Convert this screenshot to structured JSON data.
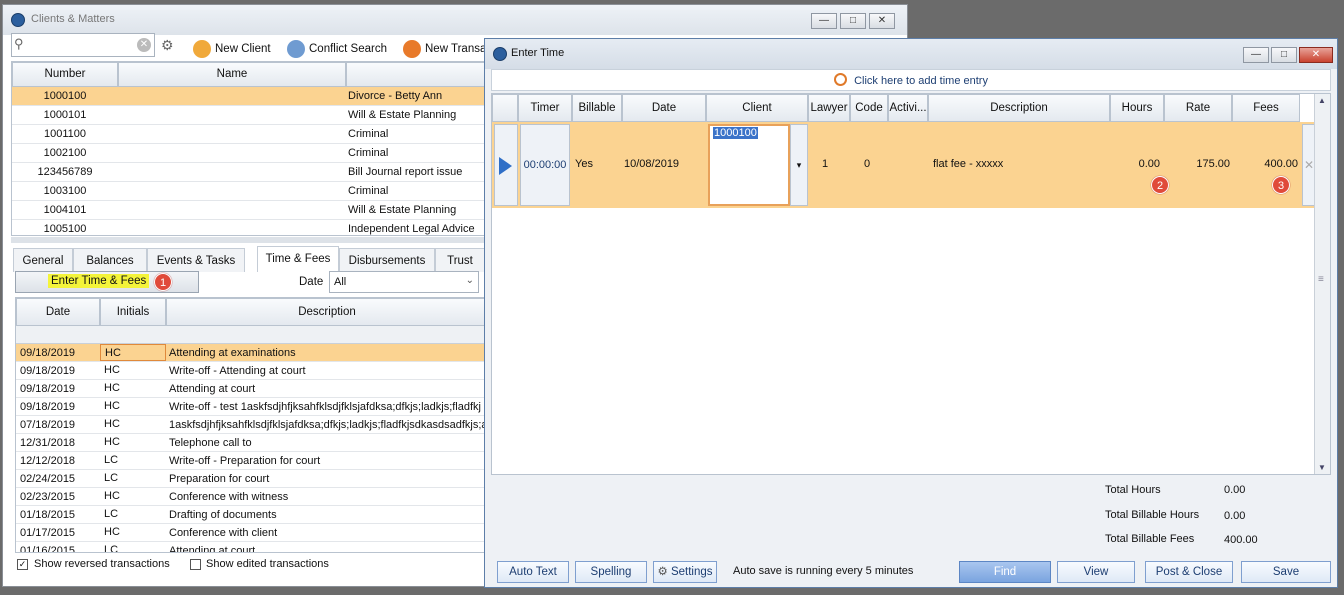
{
  "clients_window": {
    "title": "Clients & Matters",
    "toolbar": {
      "new_client": "New Client",
      "conflict_search": "Conflict Search",
      "new_transaction": "New Transa"
    },
    "columns": [
      "Number",
      "Name"
    ],
    "rows": [
      {
        "number": "1000100",
        "matter": "Divorce - Betty Ann"
      },
      {
        "number": "1000101",
        "matter": "Will & Estate Planning"
      },
      {
        "number": "1001100",
        "matter": "Criminal"
      },
      {
        "number": "1002100",
        "matter": "Criminal"
      },
      {
        "number": "123456789",
        "matter": "Bill Journal report issue"
      },
      {
        "number": "1003100",
        "matter": "Criminal"
      },
      {
        "number": "1004101",
        "matter": "Will & Estate Planning"
      },
      {
        "number": "1005100",
        "matter": "Independent Legal Advice"
      }
    ],
    "tabs": [
      "General",
      "Balances",
      "Events & Tasks",
      "Time & Fees",
      "Disbursements",
      "Trust"
    ],
    "enter_time_button": "Enter Time & Fees",
    "date_filter_label": "Date",
    "date_filter_value": "All",
    "txn_columns": [
      "Date",
      "Initials",
      "Description"
    ],
    "transactions": [
      {
        "date": "09/18/2019",
        "initials": "HC",
        "description": "Attending at examinations"
      },
      {
        "date": "09/18/2019",
        "initials": "HC",
        "description": "Write-off -  Attending at court"
      },
      {
        "date": "09/18/2019",
        "initials": "HC",
        "description": "Attending at court"
      },
      {
        "date": "09/18/2019",
        "initials": "HC",
        "description": "Write-off  -  test  1askfsdjhfjksahfklsdjfklsjafdksa;dfkjs;ladkjs;fladfkj"
      },
      {
        "date": "07/18/2019",
        "initials": "HC",
        "description": "1askfsdjhfjksahfklsdjfklsjafdksa;dfkjs;ladkjs;fladfkjsdkasdsadfkjs;a"
      },
      {
        "date": "12/31/2018",
        "initials": "HC",
        "description": "Telephone call to"
      },
      {
        "date": "12/12/2018",
        "initials": "LC",
        "description": "Write-off -  Preparation for court"
      },
      {
        "date": "02/24/2015",
        "initials": "LC",
        "description": "Preparation for court"
      },
      {
        "date": "02/23/2015",
        "initials": "HC",
        "description": "Conference with witness"
      },
      {
        "date": "01/18/2015",
        "initials": "LC",
        "description": "Drafting of documents"
      },
      {
        "date": "01/17/2015",
        "initials": "HC",
        "description": "Conference with client"
      },
      {
        "date": "01/16/2015",
        "initials": "LC",
        "description": "Attending at court"
      }
    ],
    "show_reversed": "Show reversed transactions",
    "show_edited": "Show edited transactions"
  },
  "enter_time_window": {
    "title": "Enter Time",
    "add_entry": "Click here to add time entry",
    "columns": [
      "Timer",
      "Billable",
      "Date",
      "Client",
      "Lawyer",
      "Code",
      "Activi...",
      "Description",
      "Hours",
      "Rate",
      "Fees"
    ],
    "entry": {
      "timer": "00:00:00",
      "billable": "Yes",
      "date": "10/08/2019",
      "client": "1000100",
      "lawyer": "1",
      "code": "0",
      "activity": "",
      "description": "flat fee - xxxxx",
      "hours": "0.00",
      "rate": "175.00",
      "fees": "400.00"
    },
    "totals": {
      "total_hours_label": "Total Hours",
      "total_hours": "0.00",
      "billable_hours_label": "Total Billable Hours",
      "billable_hours": "0.00",
      "billable_fees_label": "Total Billable Fees",
      "billable_fees": "400.00"
    },
    "buttons": {
      "auto_text": "Auto Text",
      "spelling": "Spelling",
      "settings": "Settings",
      "find": "Find",
      "view": "View",
      "post_close": "Post & Close",
      "save": "Save"
    },
    "autosave": "Auto save is running every 5 minutes"
  },
  "badges": [
    "1",
    "2",
    "3"
  ],
  "colors": {
    "selected_row": "#fbd391",
    "highlight": "#f4f43a",
    "badge": "#e04a3a",
    "accent": "#2c5f9e"
  }
}
